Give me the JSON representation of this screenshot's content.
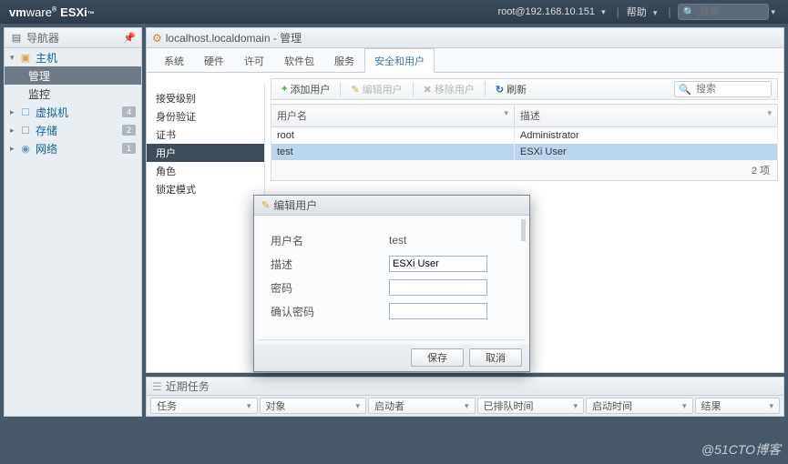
{
  "banner": {
    "brand_vm": "vm",
    "brand_ware": "ware",
    "brand_prod": "ESXi",
    "host": "root@192.168.10.151",
    "help": "帮助",
    "search_placeholder": "搜索"
  },
  "nav": {
    "title": "导航器",
    "host_label": "主机",
    "manage_label": "管理",
    "monitor_label": "监控",
    "vm_label": "虚拟机",
    "vm_count": "4",
    "storage_label": "存储",
    "storage_count": "2",
    "network_label": "网络",
    "network_count": "1"
  },
  "breadcrumb": "localhost.localdomain - 管理",
  "tabs": [
    "系统",
    "硬件",
    "许可",
    "软件包",
    "服务",
    "安全和用户"
  ],
  "active_tab": 5,
  "subnav": [
    "接受级别",
    "身份验证",
    "证书",
    "用户",
    "角色",
    "锁定模式"
  ],
  "active_sub": 3,
  "toolbar": {
    "add": "添加用户",
    "edit": "编辑用户",
    "remove": "移除用户",
    "refresh": "刷新",
    "search_placeholder": "搜索"
  },
  "columns": {
    "user": "用户名",
    "desc": "描述"
  },
  "rows": [
    {
      "user": "root",
      "desc": "Administrator"
    },
    {
      "user": "test",
      "desc": "ESXi User"
    }
  ],
  "footer_count": "2 项",
  "modal": {
    "title": "编辑用户",
    "username_label": "用户名",
    "username_value": "test",
    "desc_label": "描述",
    "desc_value": "ESXi User",
    "pwd_label": "密码",
    "pwd2_label": "确认密码",
    "save": "保存",
    "cancel": "取消"
  },
  "tasks": {
    "title": "近期任务",
    "filters": [
      "任务",
      "对象",
      "启动者",
      "已排队时间",
      "启动时间",
      "结果"
    ]
  },
  "watermark": "@51CTO博客"
}
